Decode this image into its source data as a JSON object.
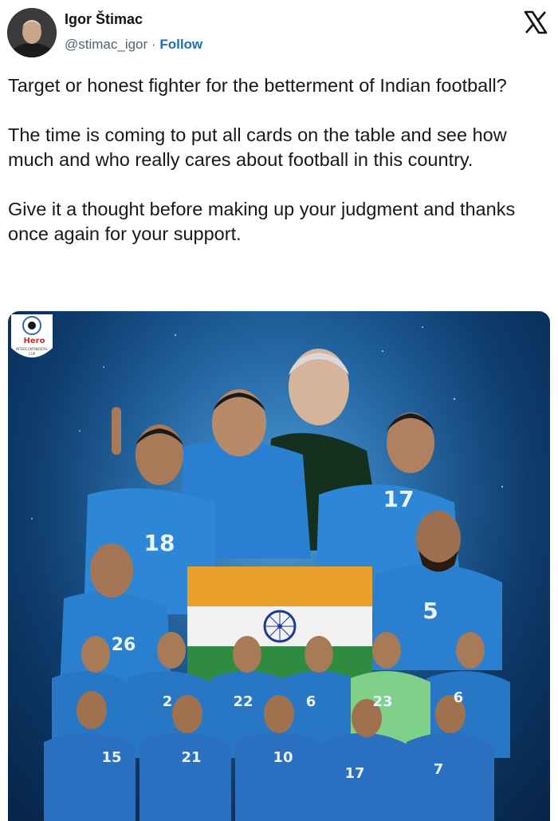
{
  "author": {
    "name": "Igor Štimac",
    "handle": "@stimac_igor",
    "separator": "·",
    "follow_label": "Follow"
  },
  "icons": {
    "logo": "x-logo-icon",
    "avatar": "profile-photo"
  },
  "tweet": {
    "paragraphs": [
      "Target or honest fighter for the betterment of Indian football?",
      "The time is coming to put all cards on the table and see how much and who really cares about football in this country.",
      "Give it a thought before making up your judgment and thanks once again for your support."
    ]
  },
  "media": {
    "badge_brand": "Hero",
    "badge_sub": "INTERCONTINENTAL",
    "badge_cup": "CUP",
    "jersey_numbers": [
      "18",
      "17",
      "26",
      "5",
      "22",
      "2",
      "6",
      "23",
      "6",
      "15",
      "21",
      "10",
      "17",
      "7"
    ]
  },
  "colors": {
    "follow": "#1d6fb8",
    "handle": "#536471",
    "saffron": "#e8a02a",
    "green": "#2e8b3f",
    "chakra": "#1f3a93"
  }
}
